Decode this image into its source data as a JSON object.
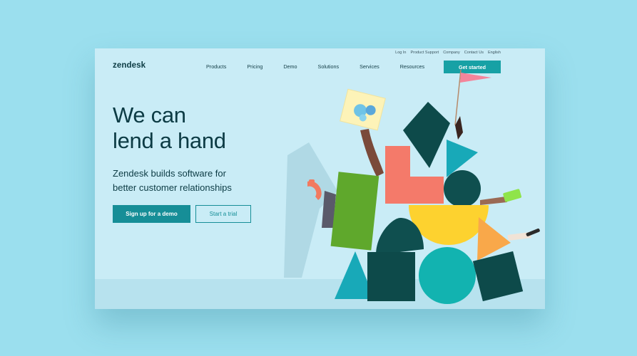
{
  "utility_nav": [
    "Log In",
    "Product Support",
    "Company",
    "Contact Us",
    "English"
  ],
  "brand": {
    "logo_text": "zendesk"
  },
  "nav": {
    "items": [
      "Products",
      "Pricing",
      "Demo",
      "Solutions",
      "Services",
      "Resources"
    ],
    "cta_label": "Get started"
  },
  "hero": {
    "headline_line1": "We can",
    "headline_line2": "lend a hand",
    "subtitle_line1": "Zendesk builds software for",
    "subtitle_line2": "better customer relationships",
    "primary_button": "Sign up for a demo",
    "secondary_button": "Start a trial"
  },
  "colors": {
    "background": "#9bdfee",
    "page": "#c9ecf6",
    "accent": "#17a1a5",
    "dark_text": "#0c3b44",
    "coral": "#f47a6a",
    "green": "#5fa82c",
    "yellow": "#fdd22f",
    "orange": "#f9a84a",
    "dark_teal": "#0d4a4a"
  },
  "hero_art": {
    "icon": "colorful-block-stack-illustration",
    "shapes": [
      "green-rectangle",
      "coral-l-block",
      "dark-teal-semicircle",
      "teal-triangle",
      "dark-teal-circle",
      "yellow-semicircle",
      "orange-triangle",
      "dark-teal-square",
      "teal-circle",
      "teal-triangle-bottom",
      "dark-teal-box"
    ],
    "props": [
      "drawing-card-icon",
      "pink-flag-icon",
      "telephone-handset-icon",
      "smartphone-icon",
      "microphone-icon"
    ]
  }
}
